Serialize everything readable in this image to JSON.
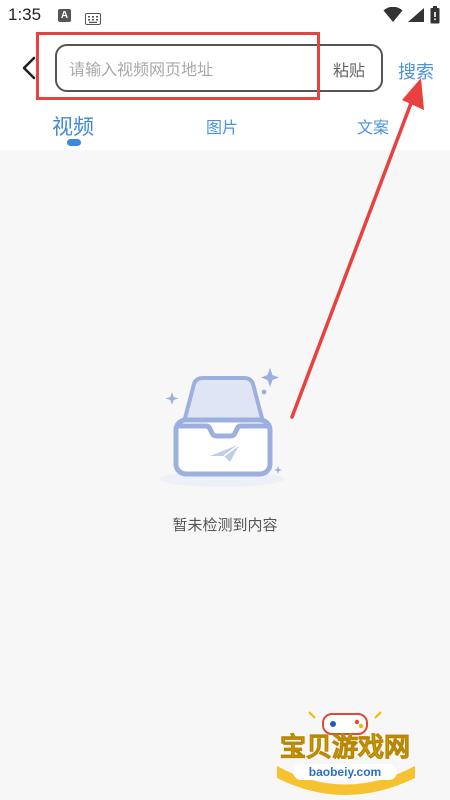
{
  "status_bar": {
    "time": "1:35",
    "a_icon_letter": "A"
  },
  "header": {
    "search_placeholder": "请输入视频网页地址",
    "search_value": "",
    "paste_label": "粘贴",
    "search_label": "搜索"
  },
  "tabs": [
    {
      "label": "视频",
      "active": true
    },
    {
      "label": "图片",
      "active": false
    },
    {
      "label": "文案",
      "active": false
    }
  ],
  "empty_state": {
    "message": "暂未检测到内容"
  },
  "watermark": {
    "name": "宝贝游戏网",
    "url": "baobeiy.com"
  },
  "colors": {
    "accent": "#3f8ad8",
    "annotation": "#e8413f",
    "illustration": "#9cb0e0"
  }
}
